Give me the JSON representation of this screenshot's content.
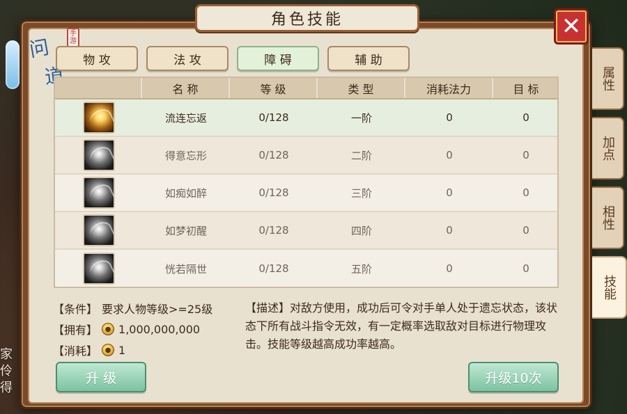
{
  "window": {
    "title": "角色技能",
    "close_symbol": "✕"
  },
  "logo": {
    "lines": [
      "问",
      "道"
    ],
    "stamp": "手游"
  },
  "top_tabs": [
    {
      "label": "物 攻",
      "active": false
    },
    {
      "label": "法 攻",
      "active": false
    },
    {
      "label": "障 碍",
      "active": true
    },
    {
      "label": "辅 助",
      "active": false
    }
  ],
  "side_tabs": [
    {
      "label": "属性",
      "active": false
    },
    {
      "label": "加点",
      "active": false
    },
    {
      "label": "相性",
      "active": false
    },
    {
      "label": "技能",
      "active": true
    }
  ],
  "table": {
    "headers": [
      "",
      "名 称",
      "等 级",
      "类 型",
      "消耗法力",
      "目 标"
    ],
    "rows": [
      {
        "icon": "skill-icon-gold",
        "name": "流连忘返",
        "level": "0/128",
        "type": "一阶",
        "mana": "0",
        "target": "0",
        "selected": true
      },
      {
        "icon": "skill-icon-gray",
        "name": "得意忘形",
        "level": "0/128",
        "type": "二阶",
        "mana": "0",
        "target": "0",
        "selected": false
      },
      {
        "icon": "skill-icon-gray",
        "name": "如痴如醉",
        "level": "0/128",
        "type": "三阶",
        "mana": "0",
        "target": "0",
        "selected": false
      },
      {
        "icon": "skill-icon-gray",
        "name": "如梦初醒",
        "level": "0/128",
        "type": "四阶",
        "mana": "0",
        "target": "0",
        "selected": false
      },
      {
        "icon": "skill-icon-gray",
        "name": "恍若隔世",
        "level": "0/128",
        "type": "五阶",
        "mana": "0",
        "target": "0",
        "selected": false
      }
    ]
  },
  "requirements": {
    "condition_label": "【条件】",
    "condition_text": "要求人物等级>=25级",
    "owned_label": "【拥有】",
    "owned_value": "1,000,000,000",
    "cost_label": "【消耗】",
    "cost_value": "1"
  },
  "description": {
    "label": "【描述】",
    "text": "对敌方使用，成功后可令对手单人处于遗忘状态，该状态下所有战斗指令无效，有一定概率选取敌对目标进行物理攻击。技能等级越高成功率越高。"
  },
  "buttons": {
    "upgrade": "升 级",
    "upgrade10": "升级10次"
  },
  "background_text": {
    "chars": [
      "家",
      "伶",
      "得"
    ]
  },
  "colors": {
    "active_tab_bg": "#e3f1da",
    "button_green": "#7cc3a1",
    "close_red": "#c73131"
  }
}
